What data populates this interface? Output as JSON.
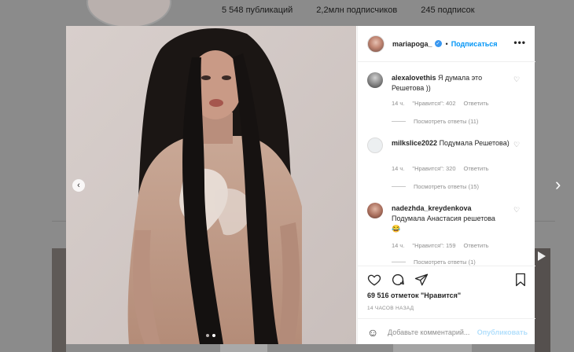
{
  "profile": {
    "stats": [
      {
        "label": "5 548 публикаций"
      },
      {
        "label": "2,2млн подписчиков"
      },
      {
        "label": "245 подписок"
      }
    ]
  },
  "post": {
    "username": "mariapoga_",
    "bullet": "•",
    "follow_label": "Подписаться",
    "more_icon": "more-horizontal-icon",
    "image_count": 2,
    "active_image": 2,
    "likes": "69 516 отметок \"Нравится\"",
    "time": "14 ЧАСОВ НАЗАД",
    "comment_placeholder": "Добавьте комментарий...",
    "post_label": "Опубликовать"
  },
  "comments": [
    {
      "user": "alexalovethis",
      "text": "Я думала это Решетова ))",
      "time": "14 ч.",
      "likes": "\"Нравится\": 402",
      "reply": "Ответить",
      "view_replies": "Посмотреть ответы (11)"
    },
    {
      "user": "milkslice2022",
      "text": "Подумала Решетова)",
      "time": "14 ч.",
      "likes": "\"Нравится\": 320",
      "reply": "Ответить",
      "view_replies": "Посмотреть ответы (15)"
    },
    {
      "user": "nadezhda_kreydenkova",
      "text": "Подумала Анастасия решетова",
      "emoji": "😂",
      "time": "14 ч.",
      "likes": "\"Нравится\": 159",
      "reply": "Ответить",
      "view_replies": "Посмотреть ответы (1)"
    }
  ],
  "colors": {
    "accent": "#0095f6",
    "text": "#262626",
    "muted": "#8e8e8e",
    "overlay": "#8a8a8a"
  }
}
